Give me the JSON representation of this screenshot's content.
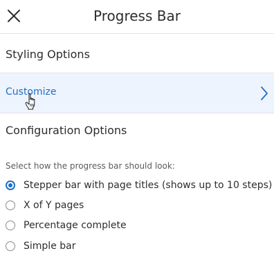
{
  "header": {
    "title": "Progress Bar"
  },
  "styling": {
    "title": "Styling Options",
    "customize_label": "Customize"
  },
  "configuration": {
    "title": "Configuration Options",
    "hint": "Select how the progress bar should look:",
    "options": [
      {
        "label": "Stepper bar with page titles (shows up to 10 steps)",
        "selected": true
      },
      {
        "label": "X of Y pages",
        "selected": false
      },
      {
        "label": "Percentage complete",
        "selected": false
      },
      {
        "label": "Simple bar",
        "selected": false
      }
    ]
  },
  "icons": {
    "close": "close-icon",
    "chevron": "chevron-right-icon",
    "cursor": "hand-pointer-cursor-icon"
  },
  "colors": {
    "accent": "#1f6fc5",
    "highlight_row": "#eef4fd",
    "divider": "#e3e3e3"
  }
}
